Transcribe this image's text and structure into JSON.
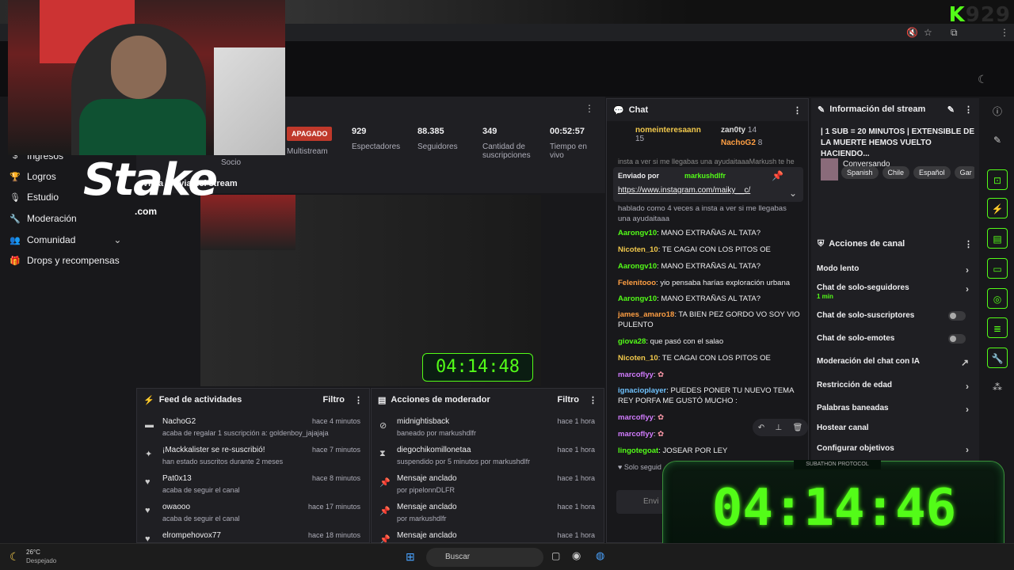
{
  "brand": {
    "k": "K",
    "num": "929"
  },
  "sidebar": {
    "items": [
      {
        "label": "Ingresos"
      },
      {
        "label": "Logros"
      },
      {
        "label": "Estudio"
      },
      {
        "label": "Moderación"
      },
      {
        "label": "Comunidad"
      },
      {
        "label": "Drops y recompensas"
      }
    ],
    "socio": "Socio"
  },
  "overlay": {
    "stake": "Stake",
    "stake_com": ".com"
  },
  "stats": {
    "status": "APAGADO",
    "multistream": "Multistream",
    "items": [
      {
        "value": "929",
        "label": "Espectadores"
      },
      {
        "value": "88.385",
        "label": "Seguidores"
      },
      {
        "value": "349",
        "label": "Cantidad de suscripciones"
      },
      {
        "value": "00:52:57",
        "label": "Tiempo en vivo"
      }
    ]
  },
  "preview": {
    "title": "Vista previa del stream",
    "timer": "04:14:48"
  },
  "feed": {
    "title": "Feed de actividades",
    "filter": "Filtro",
    "rows": [
      {
        "title": "NachoG2",
        "sub": "acaba de regalar 1 suscripción a: goldenboy_jajajaja",
        "when": "hace 4 minutos"
      },
      {
        "title": "¡Mackkalister se re-suscribió!",
        "sub": "han estado suscritos durante 2 meses",
        "when": "hace 7 minutos"
      },
      {
        "title": "Pat0x13",
        "sub": "acaba de seguir el canal",
        "when": "hace 8 minutos"
      },
      {
        "title": "owaooo",
        "sub": "acaba de seguir el canal",
        "when": "hace 17 minutos"
      },
      {
        "title": "elrompehovox77",
        "sub": "",
        "when": "hace 18 minutos"
      }
    ]
  },
  "mod": {
    "title": "Acciones de moderador",
    "filter": "Filtro",
    "rows": [
      {
        "title": "midnightisback",
        "sub": "baneado por markushdlfr",
        "when": "hace 1 hora"
      },
      {
        "title": "diegochikomillonetaa",
        "sub": "suspendido por 5 minutos por markushdlfr",
        "when": "hace 1 hora"
      },
      {
        "title": "Mensaje anclado",
        "sub": "por pipelonnDLFR",
        "when": "hace 1 hora"
      },
      {
        "title": "Mensaje anclado",
        "sub": "por markushdlfr",
        "when": "hace 1 hora"
      },
      {
        "title": "Mensaje anclado",
        "sub": "",
        "when": "hace 1 hora"
      }
    ]
  },
  "chat": {
    "title": "Chat",
    "top": [
      {
        "name": "nomeinteresaann",
        "count": "15"
      },
      {
        "name": "zan0ty",
        "count": "14"
      },
      {
        "name": "NachoG2",
        "count": "8"
      }
    ],
    "pinned_by": "Enviado por",
    "pinned_user": "markushdlfr",
    "pinned_link": "https://www.instagram.com/maiky__c/",
    "pinned_above": "insta a ver si me llegabas una ayudaitaaaMarkush te he",
    "pinned_below": "hablado como 4 veces a insta a ver si me llegabas una ayudaitaaa",
    "messages": [
      {
        "user": "Aarongv10",
        "text": "MANO EXTRAÑAS AL TATA?"
      },
      {
        "user": "Nicoten_10",
        "text": "TE CAGAI CON LOS PITOS OE"
      },
      {
        "user": "Aarongv10",
        "text": "MANO EXTRAÑAS AL TATA?"
      },
      {
        "user": "Felenitooo",
        "text": "yio pensaba harías exploración urbana"
      },
      {
        "user": "Aarongv10",
        "text": "MANO EXTRAÑAS AL TATA?"
      },
      {
        "user": "james_amaro18",
        "text": "TA BIEN PEZ GORDO VO SOY VIO PULENTO"
      },
      {
        "user": "giova28",
        "text": "que pasó con el salao"
      },
      {
        "user": "Nicoten_10",
        "text": "TE CAGAI CON LOS PITOS OE"
      },
      {
        "user": "marcoflyy",
        "text": ""
      },
      {
        "user": "ignacioplayer",
        "text": "PUEDES PONER TU NUEVO TEMA REY PORFA ME GUSTÓ MUCHO :"
      },
      {
        "user": "marcoflyy",
        "text": ""
      },
      {
        "user": "marcoflyy",
        "text": ""
      },
      {
        "user": "lingotegoat",
        "text": "JOSEAR POR LEY"
      }
    ],
    "followers_only": "Solo seguid",
    "send_placeholder": "Envi"
  },
  "info": {
    "title": "Información del stream",
    "stream_title": "| 1 SUB = 20 MINUTOS | EXTENSIBLE DE LA MUERTE HEMOS VUELTO HACIENDO...",
    "category": "Conversando",
    "tags": [
      "Spanish",
      "Chile",
      "Español",
      "Gar"
    ]
  },
  "actions": {
    "title": "Acciones de canal",
    "rows": [
      {
        "label": "Modo lento",
        "kind": "chevron",
        "sub": ""
      },
      {
        "label": "Chat de solo-seguidores",
        "kind": "chevron",
        "sub": "1 min"
      },
      {
        "label": "Chat de solo-suscriptores",
        "kind": "toggle",
        "sub": ""
      },
      {
        "label": "Chat de solo-emotes",
        "kind": "toggle",
        "sub": ""
      },
      {
        "label": "Moderación del chat con IA",
        "kind": "external",
        "sub": ""
      },
      {
        "label": "Restricción de edad",
        "kind": "chevron",
        "sub": ""
      },
      {
        "label": "Palabras baneadas",
        "kind": "chevron",
        "sub": ""
      },
      {
        "label": "Hostear canal",
        "kind": "none",
        "sub": ""
      },
      {
        "label": "Configurar objetivos",
        "kind": "chevron",
        "sub": ""
      }
    ]
  },
  "timer": {
    "label": "SUBATHON PROTOCOL",
    "value": "04:14:46"
  },
  "taskbar": {
    "temp": "26°C",
    "weather": "Despejado",
    "search": "Buscar"
  }
}
